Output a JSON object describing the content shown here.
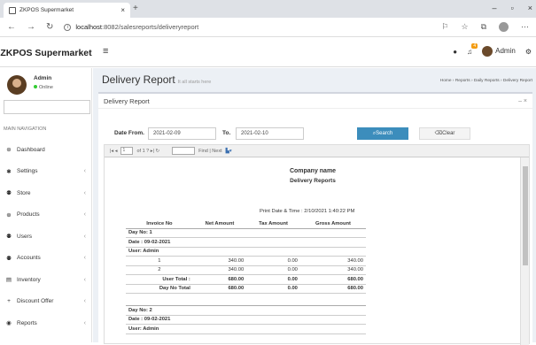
{
  "browser": {
    "tab_title": "ZKPOS Supermarket",
    "tab_close": "×",
    "new_tab": "+",
    "back": "←",
    "forward": "→",
    "reload": "↻",
    "url_host": "localhost",
    "url_rest": ":8082/salesreports/deliveryreport",
    "win_min": "–",
    "win_max": "▫",
    "win_close": "×"
  },
  "app": {
    "brand": "ZKPOS Supermarket",
    "topbar": {
      "badge": "4",
      "user": "Admin"
    }
  },
  "sidebar": {
    "user_name": "Admin",
    "status": "Online",
    "nav_header": "MAIN NAVIGATION",
    "items": [
      {
        "label": "Dashboard",
        "icon": "dashboard-icon",
        "glyph": "⊛",
        "chevron": false
      },
      {
        "label": "Settings",
        "icon": "settings-icon",
        "glyph": "✱",
        "chevron": true
      },
      {
        "label": "Store",
        "icon": "store-icon",
        "glyph": "⚉",
        "chevron": true
      },
      {
        "label": "Products",
        "icon": "products-icon",
        "glyph": "⊕",
        "chevron": true
      },
      {
        "label": "Users",
        "icon": "users-icon",
        "glyph": "⚉",
        "chevron": true
      },
      {
        "label": "Accounts",
        "icon": "accounts-icon",
        "glyph": "⚉",
        "chevron": true
      },
      {
        "label": "Inventory",
        "icon": "inventory-icon",
        "glyph": "▤",
        "chevron": true
      },
      {
        "label": "Discount Offer",
        "icon": "plus-icon",
        "glyph": "+",
        "chevron": true
      },
      {
        "label": "Reports",
        "icon": "reports-icon",
        "glyph": "◉",
        "chevron": true
      }
    ]
  },
  "page": {
    "title": "Delivery Report",
    "subtitle": "It all starts here",
    "breadcrumb": "Home › Reports › Daily Reports › Delivery Report",
    "box_title": "Delivery Report",
    "box_tools": "–  ×"
  },
  "form": {
    "date_from_label": "Date From.",
    "date_from": "2021-02-09",
    "to_label": "To.",
    "date_to": "2021-02-10",
    "search_btn": "Search",
    "clear_btn": "Clear"
  },
  "viewer": {
    "page_input": "1",
    "page_of": "of 1 ? ▸|  ↻",
    "find_next": "Find | Next",
    "nav_first": "|◂ ◂"
  },
  "report": {
    "company": "Company name",
    "name": "Delivery Reports",
    "print_date": "Print Date & Time : 2/10/2021 1:40:22 PM",
    "columns": [
      "Invoice No",
      "Net Amount",
      "Tax Amount",
      "Gross Amount"
    ],
    "groups": [
      {
        "day": "Day No: 1",
        "date": "Date : 09-02-2021",
        "user": "User: Admin",
        "rows": [
          [
            "1",
            "340.00",
            "0.00",
            "340.00"
          ],
          [
            "2",
            "340.00",
            "0.00",
            "340.00"
          ]
        ],
        "user_total": [
          "User Total :",
          "680.00",
          "0.00",
          "680.00"
        ],
        "day_total": [
          "Day No Total",
          "680.00",
          "0.00",
          "680.00"
        ]
      },
      {
        "day": "Day No: 2",
        "date": "Date : 09-02-2021",
        "user": "User: Admin"
      }
    ]
  }
}
